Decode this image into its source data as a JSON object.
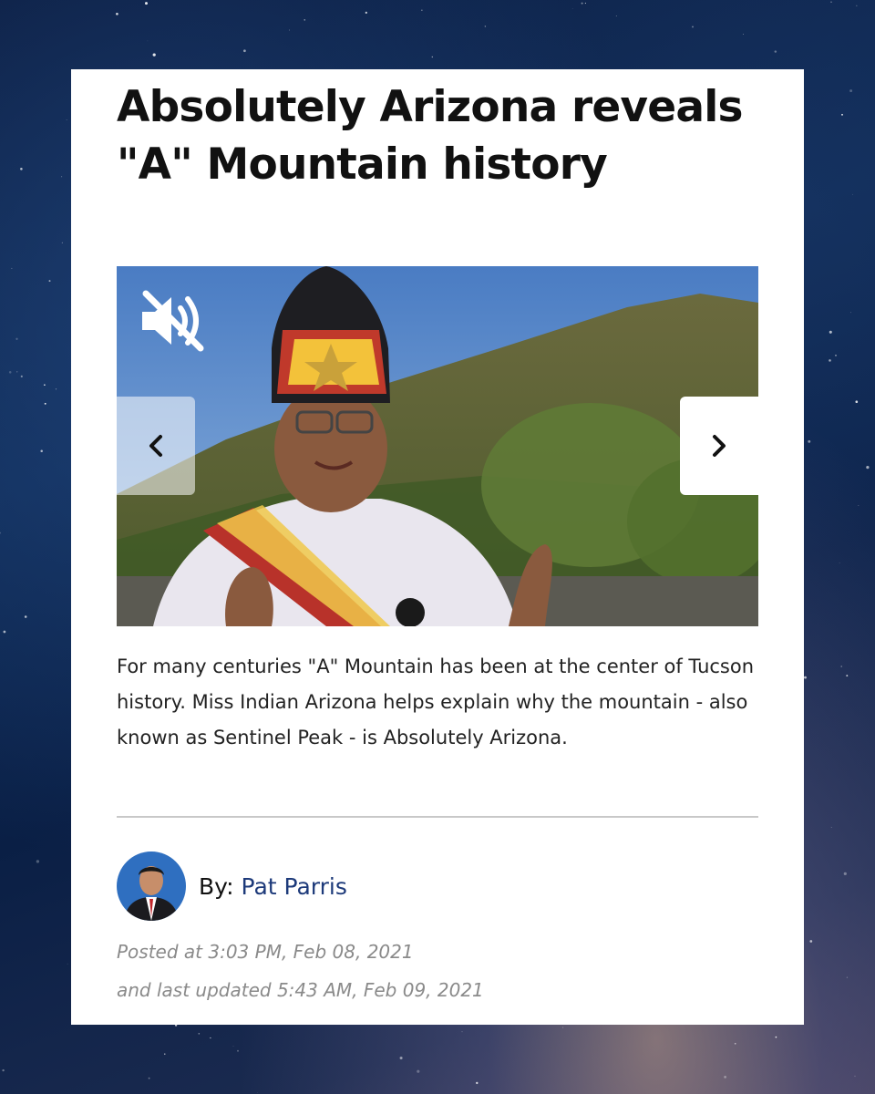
{
  "article": {
    "headline": "Absolutely Arizona reveals \"A\" Mountain history",
    "summary": "For many centuries \"A\" Mountain has been at the center of Tucson history. Miss Indian Arizona helps explain why the mountain - also known as Sentinel Peak - is Absolutely Arizona.",
    "byline_prefix": "By:",
    "author": "Pat Parris",
    "posted": "Posted at 3:03 PM, Feb 08, 2021",
    "updated": "and last updated 5:43 AM, Feb 09, 2021"
  },
  "media": {
    "mute_icon": "speaker-muted-icon",
    "prev_icon": "chevron-left-icon",
    "next_icon": "chevron-right-icon"
  },
  "colors": {
    "author_link": "#1d3a7a",
    "headline": "#111111",
    "meta_text": "#8a8a8a",
    "divider": "#c8c8c8"
  }
}
